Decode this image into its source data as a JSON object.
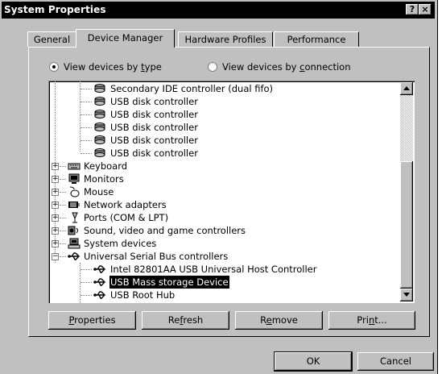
{
  "window": {
    "title": "System Properties"
  },
  "title_buttons": {
    "help": "?",
    "close": "×"
  },
  "tabs": [
    {
      "label": "General"
    },
    {
      "label": "Device Manager"
    },
    {
      "label": "Hardware Profiles"
    },
    {
      "label": "Performance"
    }
  ],
  "view_options": {
    "by_type": {
      "pre": "View devices by ",
      "key": "t",
      "post": "ype"
    },
    "by_connection": {
      "pre": "View devices by ",
      "key": "c",
      "post": "onnection"
    }
  },
  "tree": {
    "partial_top": "Secondary IDE controller (dual fifo)",
    "usb_disk": [
      "USB disk controller",
      "USB disk controller",
      "USB disk controller",
      "USB disk controller",
      "USB disk controller"
    ],
    "categories": [
      {
        "label": "Keyboard",
        "icon": "keyboard-icon"
      },
      {
        "label": "Monitors",
        "icon": "monitor-icon"
      },
      {
        "label": "Mouse",
        "icon": "mouse-icon"
      },
      {
        "label": "Network adapters",
        "icon": "network-adapter-icon"
      },
      {
        "label": "Ports (COM & LPT)",
        "icon": "port-icon"
      },
      {
        "label": "Sound, video and game controllers",
        "icon": "sound-icon"
      },
      {
        "label": "System devices",
        "icon": "computer-icon"
      }
    ],
    "usb_category": "Universal Serial Bus controllers",
    "usb_children": [
      "Intel 82801AA USB Universal Host Controller",
      "USB Mass storage Device",
      "USB Root Hub"
    ]
  },
  "buttons": {
    "properties": {
      "key": "P",
      "rest": "roperties"
    },
    "refresh": {
      "pre": "Re",
      "key": "f",
      "post": "resh"
    },
    "remove": {
      "pre": "R",
      "key": "e",
      "post": "move"
    },
    "print": {
      "pre": "Pri",
      "key": "n",
      "post": "t..."
    },
    "ok": "OK",
    "cancel": "Cancel"
  }
}
